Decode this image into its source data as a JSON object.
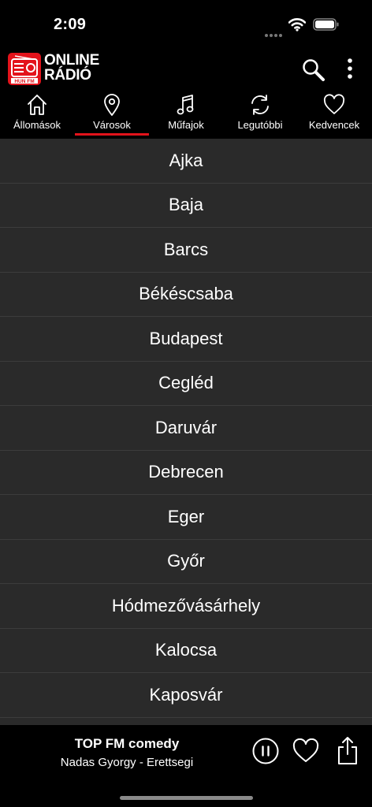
{
  "status": {
    "time": "2:09"
  },
  "header": {
    "logo_badge": "HUN FM",
    "logo_line1": "ONLINE",
    "logo_line2": "RÁDIÓ"
  },
  "tabs": [
    {
      "label": "Állomások",
      "icon": "home-icon"
    },
    {
      "label": "Városok",
      "icon": "map-pin-icon",
      "selected": true
    },
    {
      "label": "Műfajok",
      "icon": "music-note-icon"
    },
    {
      "label": "Legutóbbi",
      "icon": "refresh-icon"
    },
    {
      "label": "Kedvencek",
      "icon": "heart-icon"
    }
  ],
  "cities": [
    "Ajka",
    "Baja",
    "Barcs",
    "Békéscsaba",
    "Budapest",
    "Cegléd",
    "Daruvár",
    "Debrecen",
    "Eger",
    "Győr",
    "Hódmezővásárhely",
    "Kalocsa",
    "Kaposvár",
    ""
  ],
  "player": {
    "station": "TOP FM comedy",
    "track": "Nadas Gyorgy - Erettsegi"
  },
  "colors": {
    "accent": "#e3131b",
    "row_bg": "#2a2a2a",
    "divider": "#3c3c3c"
  }
}
